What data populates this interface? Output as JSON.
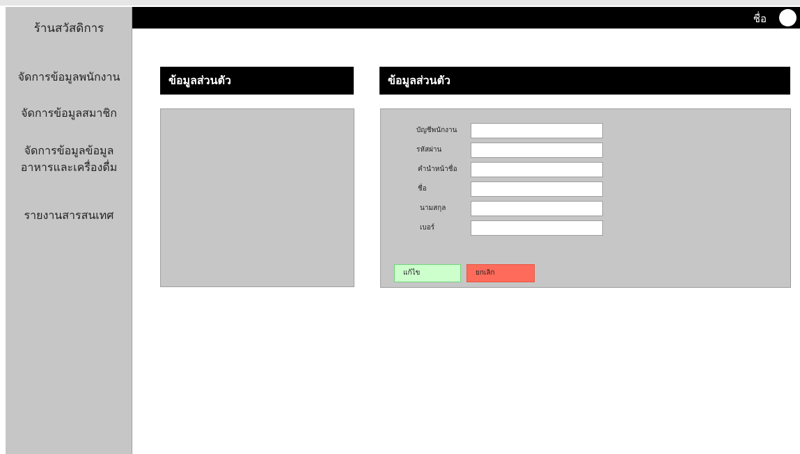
{
  "sidebar": {
    "brand": "ร้านสวัสดิการ",
    "items": [
      {
        "label": "จัดการข้อมูลพนักงาน"
      },
      {
        "label": "จัดการข้อมูลสมาชิก"
      },
      {
        "label": "จัดการข้อมูลข้อมูล\nอาหารและเครื่องดื่ม"
      },
      {
        "label": "รายงานสารสนเทศ"
      }
    ]
  },
  "topbar": {
    "user_name": "ชื่อ"
  },
  "left_panel": {
    "title": "ข้อมูลส่วนตัว"
  },
  "right_panel": {
    "title": "ข้อมูลส่วนตัว",
    "fields": [
      {
        "label": "บัญชีพนักงาน",
        "value": ""
      },
      {
        "label": "รหัสผ่าน",
        "value": ""
      },
      {
        "label": "คำนำหน้าชื่อ",
        "value": ""
      },
      {
        "label": "ชื่อ",
        "value": ""
      },
      {
        "label": "นามสกุล",
        "value": ""
      },
      {
        "label": "เบอร์",
        "value": ""
      }
    ],
    "edit_label": "แก้ไข",
    "cancel_label": "ยกเลิก"
  },
  "colors": {
    "edit_button": "#ccffcc",
    "cancel_button": "#ff6b5a"
  }
}
